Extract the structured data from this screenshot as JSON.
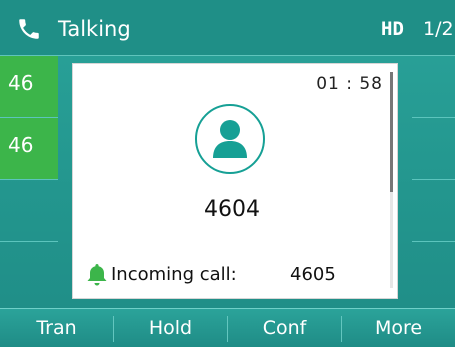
{
  "status_bar": {
    "title": "Talking",
    "hd_label": "HD",
    "page_indicator": "1/2",
    "icon": "phone-handset-icon"
  },
  "line_keys": [
    {
      "label": "46",
      "active": true
    },
    {
      "label": "46",
      "active": true
    },
    {
      "label": "",
      "active": false
    },
    {
      "label": "",
      "active": false
    }
  ],
  "call": {
    "timer": "01 : 58",
    "avatar_icon": "contact-avatar-icon",
    "number": "4604",
    "incoming_label": "Incoming call:",
    "incoming_number": "4605",
    "incoming_icon": "bell-icon"
  },
  "softkeys": [
    "Tran",
    "Hold",
    "Conf",
    "More"
  ],
  "colors": {
    "accent": "#1f8f87",
    "active_line": "#3cb54a",
    "avatar": "#16a095"
  }
}
